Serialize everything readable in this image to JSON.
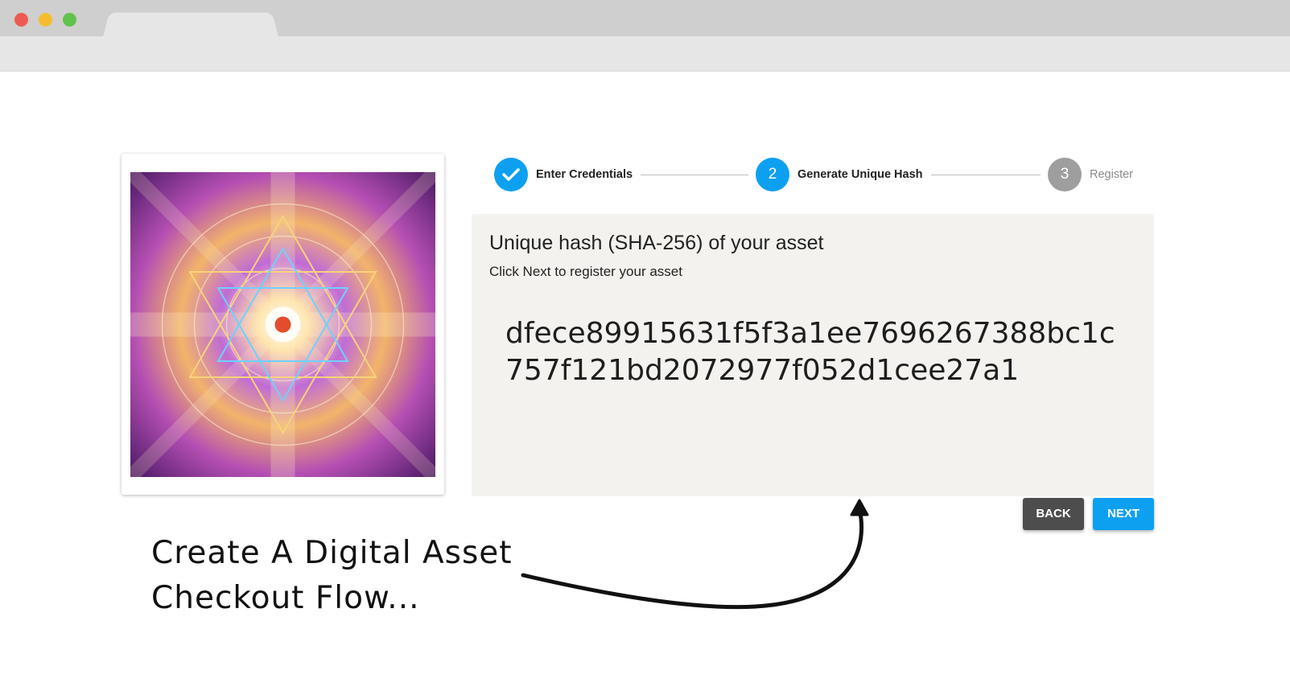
{
  "browser": {
    "window_controls": [
      "close",
      "minimize",
      "maximize"
    ]
  },
  "steps": [
    {
      "number": "",
      "label": "Enter Credentials",
      "state": "complete",
      "icon": "check-icon"
    },
    {
      "number": "2",
      "label": "Generate Unique Hash",
      "state": "active"
    },
    {
      "number": "3",
      "label": "Register",
      "state": "inactive"
    }
  ],
  "panel": {
    "title": "Unique hash (SHA-256) of your asset",
    "subtitle": "Click Next to register your asset",
    "hash": "dfece89915631f5f3a1ee7696267388bc1c757f121bd2072977f052d1cee27a1"
  },
  "buttons": {
    "back": "BACK",
    "next": "NEXT"
  },
  "annotation": {
    "line1": "Create A Digital Asset",
    "line2": "Checkout Flow..."
  },
  "colors": {
    "accent": "#0da0f1",
    "inactive": "#9e9e9e",
    "back_button": "#4d4d4d",
    "panel_bg": "#f3f2ee"
  }
}
